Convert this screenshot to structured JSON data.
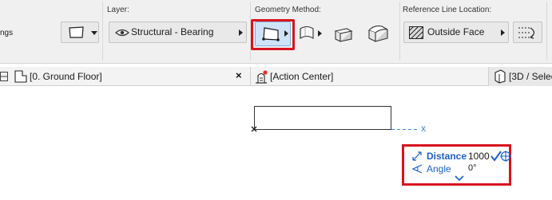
{
  "toolbar": {
    "settings_fragment": "ngs",
    "layer": {
      "label": "Layer:",
      "value": "Structural - Bearing"
    },
    "geometry_method": {
      "label": "Geometry Method:"
    },
    "reference_line": {
      "label": "Reference Line Location:",
      "value": "Outside Face"
    }
  },
  "tabs": {
    "floor_plan": {
      "label": "[0. Ground Floor]",
      "close": "×"
    },
    "action_center": {
      "label": "[Action Center]"
    },
    "view_3d": {
      "label": "[3D / Selec"
    }
  },
  "canvas": {
    "axis_label": "x"
  },
  "tracker": {
    "distance_label": "Distance",
    "distance_value": "1000",
    "angle_label": "Angle",
    "angle_value": "0°"
  },
  "colors": {
    "highlight": "#d9121f",
    "accent_blue": "#1f5fc4",
    "selected_button": "#cfe3f8"
  }
}
